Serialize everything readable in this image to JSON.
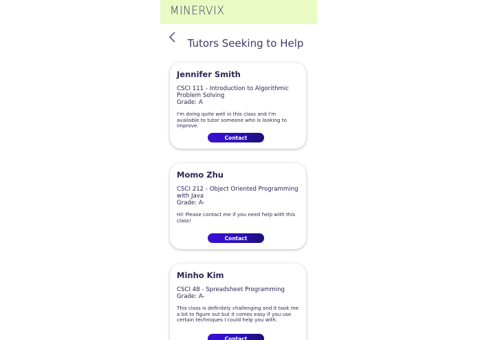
{
  "header": {
    "logo": "MINERVIX"
  },
  "page": {
    "title": "Tutors Seeking to Help"
  },
  "tutors": [
    {
      "name": "Jennifer Smith",
      "course": "CSCI 111 - Introduction to Algorithmic Problem Solving",
      "grade": "Grade: A",
      "description": "I'm doing quite well in this class and I'm available to tutor someone who is looking to improve.",
      "contact_label": "Contact"
    },
    {
      "name": "Momo Zhu",
      "course": "CSCI 212 - Object Oriented Programming with Java",
      "grade": "Grade: A-",
      "description": "Hi! Please contact me if you need help with this class!",
      "contact_label": "Contact"
    },
    {
      "name": "Minho Kim",
      "course": "CSCI 48 - Spreadsheet Programming",
      "grade": "Grade: A-",
      "description": "This class is definitely challenging and it took me a bit to figure out but it comes easy if you use certain techniques I could help you with.",
      "contact_label": "Contact"
    }
  ],
  "colors": {
    "header_bg": "#e9fbc3",
    "text": "#2b2552",
    "button_start": "#3a0fd8",
    "button_end": "#1a1170"
  },
  "icons": {
    "back": "chevron-left-icon"
  }
}
